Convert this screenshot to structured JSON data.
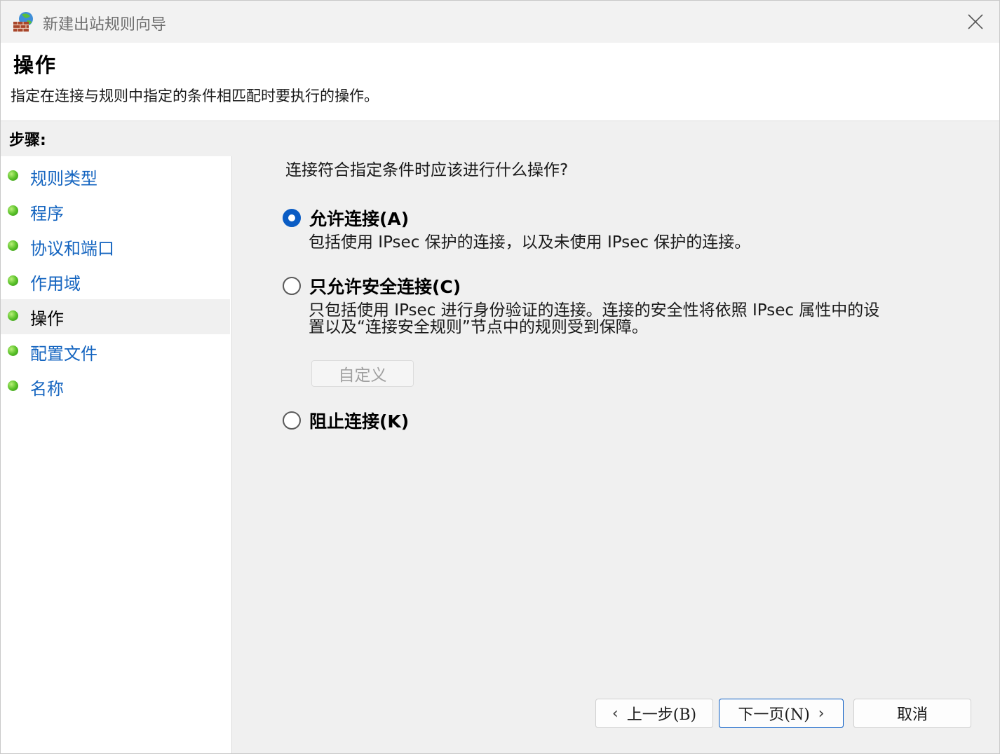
{
  "window": {
    "title": "新建出站规则向导"
  },
  "header": {
    "title": "操作",
    "subtitle": "指定在连接与规则中指定的条件相匹配时要执行的操作。"
  },
  "sidebar": {
    "steps_label": "步骤:",
    "steps": [
      {
        "label": "规则类型",
        "active": false
      },
      {
        "label": "程序",
        "active": false
      },
      {
        "label": "协议和端口",
        "active": false
      },
      {
        "label": "作用域",
        "active": false
      },
      {
        "label": "操作",
        "active": true
      },
      {
        "label": "配置文件",
        "active": false
      },
      {
        "label": "名称",
        "active": false
      }
    ]
  },
  "main": {
    "question": "连接符合指定条件时应该进行什么操作?",
    "options": [
      {
        "label": "允许连接(A)",
        "description": "包括使用 IPsec 保护的连接，以及未使用 IPsec 保护的连接。",
        "checked": true
      },
      {
        "label": "只允许安全连接(C)",
        "description_line1": "只包括使用 IPsec 进行身份验证的连接。连接的安全性将依照 IPsec 属性中的设",
        "description_line2": "置以及“连接安全规则”节点中的规则受到保障。",
        "checked": false
      },
      {
        "label": "阻止连接(K)",
        "checked": false
      }
    ],
    "customize_label": "自定义"
  },
  "buttons": {
    "back": "上一步(B)",
    "next": "下一页(N)",
    "cancel": "取消"
  },
  "icons": {
    "app": "firewall-icon",
    "close": "close-icon",
    "back_chevron": "‹",
    "next_chevron": "›"
  },
  "colors": {
    "accent": "#0a5cc4",
    "link": "#1565c0",
    "step_dot": "#5cc22a"
  }
}
